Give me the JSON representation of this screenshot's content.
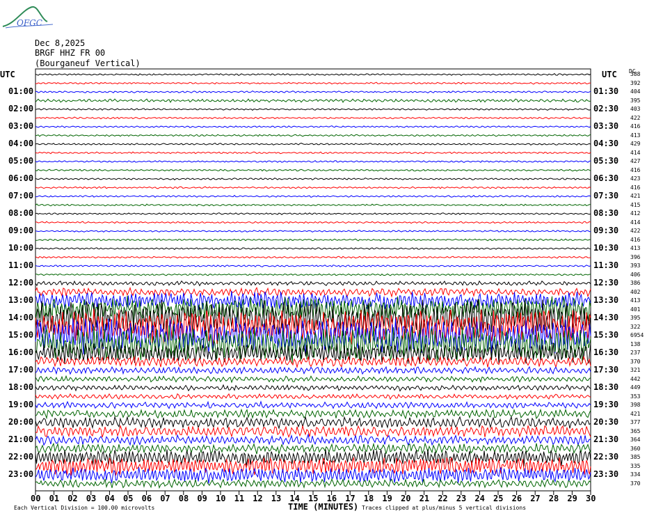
{
  "logo": {
    "text": "OFGC"
  },
  "header": {
    "date": "Dec 8,2025",
    "station": "BRGF HHZ FR 00",
    "location": "(Bourganeuf Vertical)"
  },
  "axis": {
    "left_label": "UTC",
    "right_label": "UTC",
    "count_label": "DC"
  },
  "colors": {
    "trace_cycle": [
      "#000000",
      "#ff0000",
      "#0000ff",
      "#006400"
    ]
  },
  "footer": {
    "scale_note": "Each Vertical Division = 100.00 microvolts",
    "xlabel": "TIME (MINUTES)",
    "clip_note": "Traces clipped at plus/minus 5 vertical divisions"
  },
  "chart_data": {
    "type": "line",
    "title": "BRGF HHZ FR 00 (Bourganeuf Vertical)",
    "xlabel": "TIME (MINUTES)",
    "xlim": [
      0,
      30
    ],
    "x_ticks": [
      "00",
      "01",
      "02",
      "03",
      "04",
      "05",
      "06",
      "07",
      "08",
      "09",
      "10",
      "11",
      "12",
      "13",
      "14",
      "15",
      "16",
      "17",
      "18",
      "19",
      "20",
      "21",
      "22",
      "23",
      "24",
      "25",
      "26",
      "27",
      "28",
      "29",
      "30"
    ],
    "left_labels": [
      "01:00",
      "02:00",
      "03:00",
      "04:00",
      "05:00",
      "06:00",
      "07:00",
      "08:00",
      "09:00",
      "10:00",
      "11:00",
      "12:00",
      "13:00",
      "14:00",
      "15:00",
      "16:00",
      "17:00",
      "18:00",
      "19:00",
      "20:00",
      "21:00",
      "22:00",
      "23:00"
    ],
    "right_labels": [
      "01:30",
      "02:30",
      "03:30",
      "04:30",
      "05:30",
      "06:30",
      "07:30",
      "08:30",
      "09:30",
      "10:30",
      "11:30",
      "12:30",
      "13:30",
      "14:30",
      "15:30",
      "16:30",
      "17:30",
      "18:30",
      "19:30",
      "20:30",
      "21:30",
      "22:30",
      "23:30"
    ],
    "trace_counts": [
      "388",
      "392",
      "404",
      "395",
      "403",
      "422",
      "416",
      "413",
      "429",
      "414",
      "427",
      "416",
      "423",
      "416",
      "421",
      "415",
      "412",
      "414",
      "422",
      "416",
      "413",
      "396",
      "393",
      "406",
      "386",
      "402",
      "413",
      "401",
      "395",
      "322",
      "6954",
      "138",
      "237",
      "370",
      "321",
      "442",
      "449",
      "353",
      "398",
      "421",
      "377",
      "365",
      "364",
      "360",
      "385",
      "335",
      "334",
      "370"
    ],
    "trace_amplitude": [
      0.25,
      0.25,
      0.25,
      0.45,
      0.25,
      0.25,
      0.25,
      0.25,
      0.25,
      0.25,
      0.25,
      0.25,
      0.25,
      0.25,
      0.25,
      0.25,
      0.25,
      0.25,
      0.25,
      0.25,
      0.25,
      0.25,
      0.25,
      0.25,
      0.6,
      1.2,
      2.5,
      3.5,
      5,
      5,
      5,
      5,
      3,
      1.5,
      1,
      0.8,
      0.8,
      0.7,
      0.9,
      1.2,
      1.6,
      1.6,
      1.4,
      1.4,
      2.2,
      2.5,
      2.2,
      1.2
    ],
    "vertical_division_microvolts": 100.0,
    "clip_divisions": 5
  }
}
